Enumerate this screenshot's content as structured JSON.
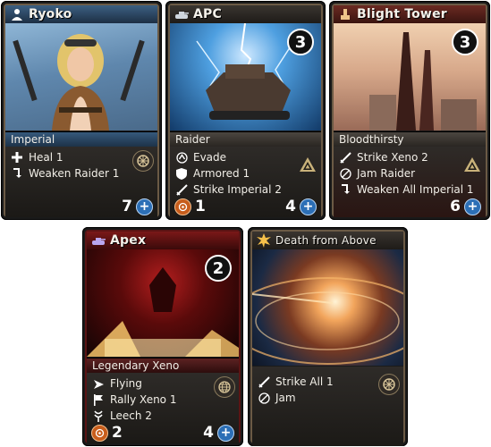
{
  "cards": {
    "ryoko": {
      "name": "Ryoko",
      "faction": "Imperial",
      "skills": [
        {
          "icon": "heal-icon",
          "label": "Heal 1"
        },
        {
          "icon": "weaken-icon",
          "label": "Weaken Raider 1"
        }
      ],
      "side_icon": "battle-icon",
      "hp": "7"
    },
    "apc": {
      "name": "APC",
      "cost": "3",
      "faction": "Raider",
      "skills": [
        {
          "icon": "evade-icon",
          "label": "Evade"
        },
        {
          "icon": "armored-icon",
          "label": "Armored 1"
        },
        {
          "icon": "strike-icon",
          "label": "Strike Imperial 2"
        }
      ],
      "side_icon": "triangle-icon",
      "attack": "1",
      "hp": "4"
    },
    "blight_tower": {
      "name": "Blight Tower",
      "cost": "3",
      "faction": "Bloodthirsty",
      "skills": [
        {
          "icon": "strike-icon",
          "label": "Strike Xeno 2"
        },
        {
          "icon": "jam-icon",
          "label": "Jam Raider"
        },
        {
          "icon": "weaken-icon",
          "label": "Weaken All Imperial 1"
        }
      ],
      "side_icon": "triangle-icon",
      "hp": "6"
    },
    "apex": {
      "name": "Apex",
      "cost": "2",
      "faction": "Legendary Xeno",
      "skills": [
        {
          "icon": "flying-icon",
          "label": "Flying"
        },
        {
          "icon": "rally-icon",
          "label": "Rally Xeno 1"
        },
        {
          "icon": "leech-icon",
          "label": "Leech 2"
        }
      ],
      "side_icon": "globe-icon",
      "attack": "2",
      "hp": "4"
    },
    "death_from_above": {
      "name": "Death from Above",
      "skills": [
        {
          "icon": "strike-icon",
          "label": "Strike All 1"
        },
        {
          "icon": "jam-icon",
          "label": "Jam"
        }
      ],
      "side_icon": "battle-icon"
    }
  },
  "colors": {
    "plus_badge": "#2c6fb6",
    "target_badge": "#c75d1c",
    "apex_title_accent": "#7a1818",
    "ryoko_title_accent": "#2f5f8a"
  }
}
